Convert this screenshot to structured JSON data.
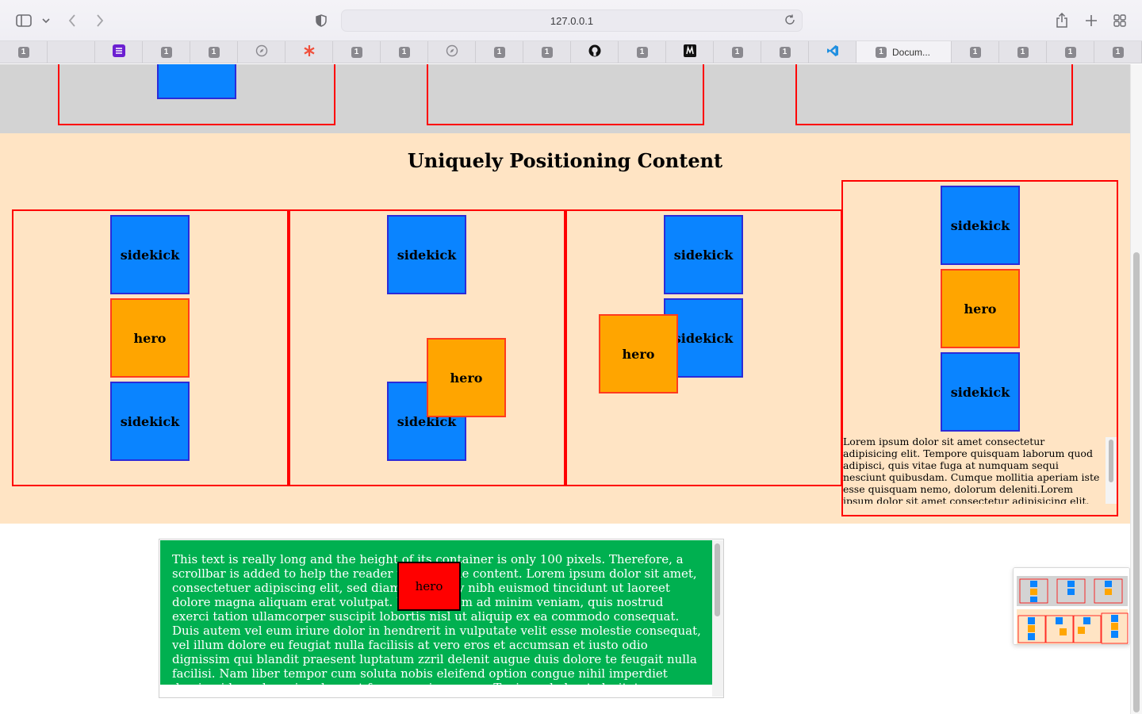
{
  "browser": {
    "url": "127.0.0.1",
    "tabs": [
      {
        "badge": "1"
      },
      {
        "badge": ""
      },
      {
        "badge": ""
      },
      {
        "badge": "1"
      },
      {
        "badge": "1"
      },
      {
        "badge": ""
      },
      {
        "badge": ""
      },
      {
        "badge": "1"
      },
      {
        "badge": "1"
      },
      {
        "badge": ""
      },
      {
        "badge": "1"
      },
      {
        "badge": "1"
      },
      {
        "badge": ""
      },
      {
        "badge": "1"
      },
      {
        "badge": ""
      },
      {
        "badge": "1"
      },
      {
        "badge": "1"
      },
      {
        "badge": ""
      },
      {
        "badge": "1",
        "title": "Docum..."
      },
      {
        "badge": "1"
      },
      {
        "badge": "1"
      },
      {
        "badge": "1"
      },
      {
        "badge": "1"
      }
    ],
    "icons": {
      "sidebar": "sidebar-icon",
      "back": "chevron-left-icon",
      "forward": "chevron-right-icon",
      "shield": "privacy-shield-icon",
      "reload": "reload-icon",
      "share": "share-icon",
      "new_tab": "plus-icon",
      "overview": "tab-overview-icon"
    }
  },
  "page": {
    "section_title": "Uniquely Positioning Content",
    "labels": {
      "sidekick": "sidekick",
      "hero": "hero"
    },
    "lorem": "Lorem ipsum dolor sit amet consectetur adipisicing elit. Tempore quisquam laborum quod adipisci, quis vitae fuga at numquam sequi nesciunt quibusdam. Cumque mollitia aperiam iste esse quisquam nemo, dolorum deleniti.Lorem ipsum dolor sit amet consectetur adipisicing elit. Tempore quisquam laborum quod adipisci, quis vitae fuga at numquam sequi",
    "green_text": "This text is really long and the height of its container is only 100 pixels. Therefore, a scrollbar is added to help the reader to scroll the content. Lorem ipsum dolor sit amet, consectetuer adipiscing elit, sed diam nonummy nibh euismod tincidunt ut laoreet dolore magna aliquam erat volutpat. Ut wisi enim ad minim veniam, quis nostrud exerci tation ullamcorper suscipit lobortis nisl ut aliquip ex ea commodo consequat. Duis autem vel eum iriure dolor in hendrerit in vulputate velit esse molestie consequat, vel illum dolore eu feugiat nulla facilisis at vero eros et accumsan et iusto odio dignissim qui blandit praesent luptatum zzril delenit augue duis dolore te feugait nulla facilisi. Nam liber tempor cum soluta nobis eleifend option congue nihil imperdiet doming id quod mazim placerat facer possim assum. Typi non habent claritatem insitam; est usus legentis in iis qui facit eorum claritatem.",
    "colors": {
      "sidekick": "#0a84ff",
      "hero": "#ffa500",
      "peach": "#ffe4c4",
      "green": "#00b050",
      "border": "#ff0000"
    }
  }
}
